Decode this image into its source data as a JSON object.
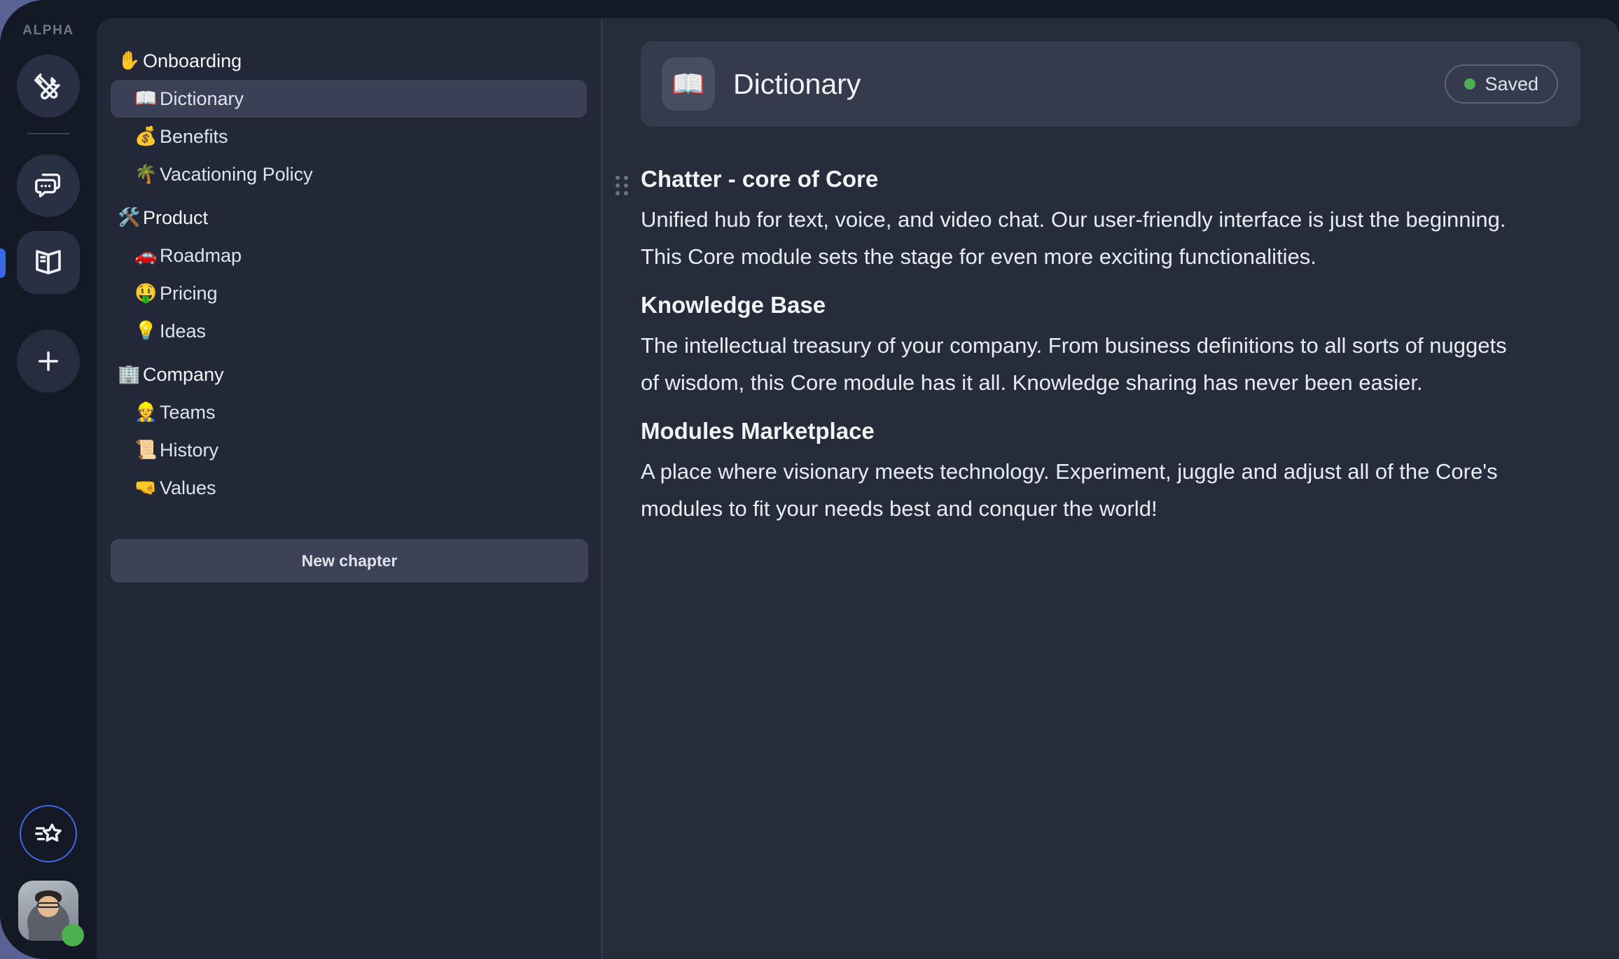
{
  "workspace": {
    "label": "ALPHA",
    "rail_items": [
      {
        "name": "tools-icon",
        "title": "Tools"
      },
      {
        "name": "chat-icon",
        "title": "Chat"
      },
      {
        "name": "book-icon",
        "title": "Knowledge",
        "active": true
      },
      {
        "name": "plus-icon",
        "title": "Add"
      }
    ],
    "star_button": "star-list-icon",
    "presence_color": "#4caf50",
    "active_indicator_color": "#3b69e8"
  },
  "sidebar": {
    "items": [
      {
        "emoji": "✋",
        "label": "Onboarding",
        "type": "section",
        "selected": false
      },
      {
        "emoji": "📖",
        "label": "Dictionary",
        "type": "child",
        "selected": true
      },
      {
        "emoji": "💰",
        "label": "Benefits",
        "type": "child",
        "selected": false
      },
      {
        "emoji": "🌴",
        "label": "Vacationing Policy",
        "type": "child",
        "selected": false
      },
      {
        "emoji": "🛠️",
        "label": "Product",
        "type": "section",
        "selected": false
      },
      {
        "emoji": "🚗",
        "label": "Roadmap",
        "type": "child",
        "selected": false
      },
      {
        "emoji": "🤑",
        "label": "Pricing",
        "type": "child",
        "selected": false
      },
      {
        "emoji": "💡",
        "label": "Ideas",
        "type": "child",
        "selected": false
      },
      {
        "emoji": "🏢",
        "label": "Company",
        "type": "section",
        "selected": false
      },
      {
        "emoji": "👷",
        "label": "Teams",
        "type": "child",
        "selected": false
      },
      {
        "emoji": "📜",
        "label": "History",
        "type": "child",
        "selected": false
      },
      {
        "emoji": "🤜",
        "label": "Values",
        "type": "child",
        "selected": false
      }
    ],
    "new_chapter_label": "New chapter"
  },
  "document": {
    "icon": "📖",
    "title": "Dictionary",
    "status": "Saved",
    "status_color": "#4caf50",
    "blocks": [
      {
        "heading": "Chatter - core of Core",
        "paragraph": "Unified hub for text, voice, and video chat. Our user-friendly interface is just the beginning. This Core module sets the stage for even more exciting functionalities."
      },
      {
        "heading": "Knowledge Base",
        "paragraph": "The intellectual treasury of your company. From business definitions to all sorts of nuggets of wisdom, this Core module has it all. Knowledge sharing has never been easier."
      },
      {
        "heading": "Modules Marketplace",
        "paragraph": "A place where visionary meets technology. Experiment, juggle and adjust all of the Core's modules to fit your needs best and conquer the world!"
      }
    ]
  },
  "theme": {
    "page_background": "#5a6193",
    "shell_background": "#141926",
    "sidebar_background": "#232839",
    "main_background": "#272c3b",
    "accent": "#3b69e8"
  }
}
